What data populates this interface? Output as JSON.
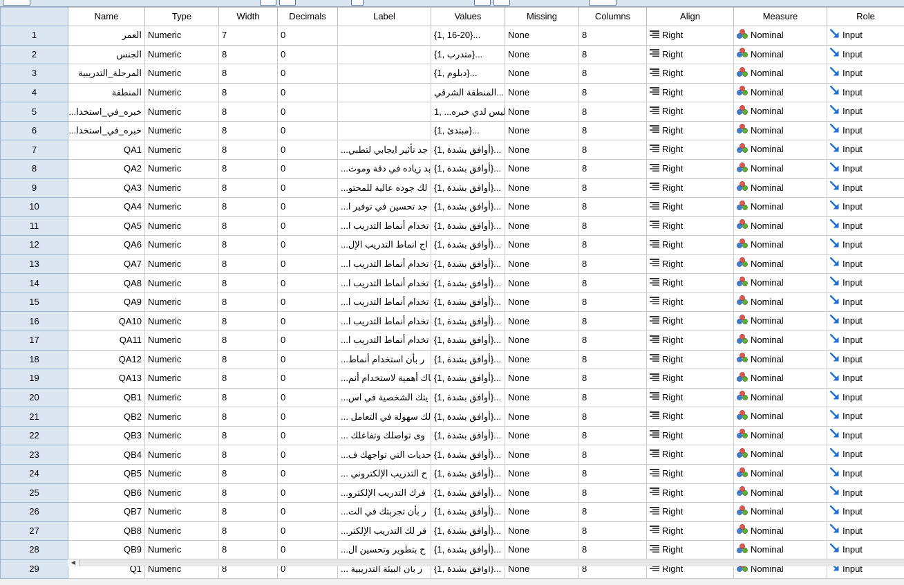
{
  "header": {
    "columns": [
      "Name",
      "Type",
      "Width",
      "Decimals",
      "Label",
      "Values",
      "Missing",
      "Columns",
      "Align",
      "Measure",
      "Role"
    ]
  },
  "rows": [
    {
      "n": "1",
      "name": "العمر",
      "type": "Numeric",
      "width": "7",
      "dec": "0",
      "label": "",
      "values": "{1, 16-20}...",
      "missing": "None",
      "cols": "8",
      "align": "Right",
      "measure": "Nominal",
      "role": "Input"
    },
    {
      "n": "2",
      "name": "الجنس",
      "type": "Numeric",
      "width": "8",
      "dec": "0",
      "label": "",
      "values": "{1, متدرب}...",
      "missing": "None",
      "cols": "8",
      "align": "Right",
      "measure": "Nominal",
      "role": "Input"
    },
    {
      "n": "3",
      "name": "المرحلة_التدريبية",
      "type": "Numeric",
      "width": "8",
      "dec": "0",
      "label": "",
      "values": "{1, دبلوم}...",
      "missing": "None",
      "cols": "8",
      "align": "Right",
      "measure": "Nominal",
      "role": "Input"
    },
    {
      "n": "4",
      "name": "المنطقة",
      "type": "Numeric",
      "width": "8",
      "dec": "0",
      "label": "",
      "values": "المنطقة الشرقي... ,",
      "missing": "None",
      "cols": "8",
      "align": "Right",
      "measure": "Nominal",
      "role": "Input"
    },
    {
      "n": "5",
      "name": "خبره_في_استخدا...",
      "type": "Numeric",
      "width": "8",
      "dec": "0",
      "label": "",
      "values": "ليس لدي خبره... ,1",
      "missing": "None",
      "cols": "8",
      "align": "Right",
      "measure": "Nominal",
      "role": "Input"
    },
    {
      "n": "6",
      "name": "خبره_في_استخدا...",
      "type": "Numeric",
      "width": "8",
      "dec": "0",
      "label": "",
      "values": "{1, مبتدئ}...",
      "missing": "None",
      "cols": "8",
      "align": "Right",
      "measure": "Nominal",
      "role": "Input"
    },
    {
      "n": "7",
      "name": "QA1",
      "type": "Numeric",
      "width": "8",
      "dec": "0",
      "label": "جد تأثير ايجابي لتطبي...",
      "values": "{1, أوافق بشدة}...",
      "missing": "None",
      "cols": "8",
      "align": "Right",
      "measure": "Nominal",
      "role": "Input"
    },
    {
      "n": "8",
      "name": "QA2",
      "type": "Numeric",
      "width": "8",
      "dec": "0",
      "label": "بد زياده في دقة وموث...",
      "values": "{1, أوافق بشدة}...",
      "missing": "None",
      "cols": "8",
      "align": "Right",
      "measure": "Nominal",
      "role": "Input"
    },
    {
      "n": "9",
      "name": "QA3",
      "type": "Numeric",
      "width": "8",
      "dec": "0",
      "label": "لك جوده عالية للمحتو...",
      "values": "{1, أوافق بشدة}...",
      "missing": "None",
      "cols": "8",
      "align": "Right",
      "measure": "Nominal",
      "role": "Input"
    },
    {
      "n": "10",
      "name": "QA4",
      "type": "Numeric",
      "width": "8",
      "dec": "0",
      "label": "جد تحسين في توفير ا...",
      "values": "{1, أوافق بشدة}...",
      "missing": "None",
      "cols": "8",
      "align": "Right",
      "measure": "Nominal",
      "role": "Input"
    },
    {
      "n": "11",
      "name": "QA5",
      "type": "Numeric",
      "width": "8",
      "dec": "0",
      "label": "تخدام أنماط التدريب ا...",
      "values": "{1, أوافق بشدة}...",
      "missing": "None",
      "cols": "8",
      "align": "Right",
      "measure": "Nominal",
      "role": "Input"
    },
    {
      "n": "12",
      "name": "QA6",
      "type": "Numeric",
      "width": "8",
      "dec": "0",
      "label": "اج انماط التدريب الإل...",
      "values": "{1, أوافق بشدة}...",
      "missing": "None",
      "cols": "8",
      "align": "Right",
      "measure": "Nominal",
      "role": "Input"
    },
    {
      "n": "13",
      "name": "QA7",
      "type": "Numeric",
      "width": "8",
      "dec": "0",
      "label": "تخدام أنماط التدريب ا...",
      "values": "{1, أوافق بشدة}...",
      "missing": "None",
      "cols": "8",
      "align": "Right",
      "measure": "Nominal",
      "role": "Input"
    },
    {
      "n": "14",
      "name": "QA8",
      "type": "Numeric",
      "width": "8",
      "dec": "0",
      "label": "تخدام أنماط التدريب ا...",
      "values": "{1, أوافق بشدة}...",
      "missing": "None",
      "cols": "8",
      "align": "Right",
      "measure": "Nominal",
      "role": "Input"
    },
    {
      "n": "15",
      "name": "QA9",
      "type": "Numeric",
      "width": "8",
      "dec": "0",
      "label": "تخدام أنماط التدريب ا...",
      "values": "{1, أوافق بشدة}...",
      "missing": "None",
      "cols": "8",
      "align": "Right",
      "measure": "Nominal",
      "role": "Input"
    },
    {
      "n": "16",
      "name": "QA10",
      "type": "Numeric",
      "width": "8",
      "dec": "0",
      "label": "تخدام أنماط التدريب ا...",
      "values": "{1, أوافق بشدة}...",
      "missing": "None",
      "cols": "8",
      "align": "Right",
      "measure": "Nominal",
      "role": "Input"
    },
    {
      "n": "17",
      "name": "QA11",
      "type": "Numeric",
      "width": "8",
      "dec": "0",
      "label": "تخدام أنماط التدريب ا...",
      "values": "{1, أوافق بشدة}...",
      "missing": "None",
      "cols": "8",
      "align": "Right",
      "measure": "Nominal",
      "role": "Input"
    },
    {
      "n": "18",
      "name": "QA12",
      "type": "Numeric",
      "width": "8",
      "dec": "0",
      "label": "ر بأن استخدام أنماط...",
      "values": "{1, أوافق بشدة}...",
      "missing": "None",
      "cols": "8",
      "align": "Right",
      "measure": "Nominal",
      "role": "Input"
    },
    {
      "n": "19",
      "name": "QA13",
      "type": "Numeric",
      "width": "8",
      "dec": "0",
      "label": "ناك أهمية لاستخدام أنم...",
      "values": "{1, أوافق بشدة}...",
      "missing": "None",
      "cols": "8",
      "align": "Right",
      "measure": "Nominal",
      "role": "Input"
    },
    {
      "n": "20",
      "name": "QB1",
      "type": "Numeric",
      "width": "8",
      "dec": "0",
      "label": "يتك الشخصية في اس...",
      "values": "{1, أوافق بشدة}...",
      "missing": "None",
      "cols": "8",
      "align": "Right",
      "measure": "Nominal",
      "role": "Input"
    },
    {
      "n": "21",
      "name": "QB2",
      "type": "Numeric",
      "width": "8",
      "dec": "0",
      "label": "لك سهولة في التعامل ...",
      "values": "{1, أوافق بشدة}...",
      "missing": "None",
      "cols": "8",
      "align": "Right",
      "measure": "Nominal",
      "role": "Input"
    },
    {
      "n": "22",
      "name": "QB3",
      "type": "Numeric",
      "width": "8",
      "dec": "0",
      "label": "وى تواصلك وتفاعلك ...",
      "values": "{1, أوافق بشدة}...",
      "missing": "None",
      "cols": "8",
      "align": "Right",
      "measure": "Nominal",
      "role": "Input"
    },
    {
      "n": "23",
      "name": "QB4",
      "type": "Numeric",
      "width": "8",
      "dec": "0",
      "label": "حديات التي تواجهك ف...",
      "values": "{1, أوافق بشدة}...",
      "missing": "None",
      "cols": "8",
      "align": "Right",
      "measure": "Nominal",
      "role": "Input"
    },
    {
      "n": "24",
      "name": "QB5",
      "type": "Numeric",
      "width": "8",
      "dec": "0",
      "label": "ح التدريب الإلكتروني ...",
      "values": "{1, أوافق بشدة}...",
      "missing": "None",
      "cols": "8",
      "align": "Right",
      "measure": "Nominal",
      "role": "Input"
    },
    {
      "n": "25",
      "name": "QB6",
      "type": "Numeric",
      "width": "8",
      "dec": "0",
      "label": "فرك التدريب الإلكترو...",
      "values": "{1, أوافق بشدة}...",
      "missing": "None",
      "cols": "8",
      "align": "Right",
      "measure": "Nominal",
      "role": "Input"
    },
    {
      "n": "26",
      "name": "QB7",
      "type": "Numeric",
      "width": "8",
      "dec": "0",
      "label": "ر بأن تجربتك في الت...",
      "values": "{1, أوافق بشدة}...",
      "missing": "None",
      "cols": "8",
      "align": "Right",
      "measure": "Nominal",
      "role": "Input"
    },
    {
      "n": "27",
      "name": "QB8",
      "type": "Numeric",
      "width": "8",
      "dec": "0",
      "label": "فر لك التدريب الإلكتر...",
      "values": "{1, أوافق بشدة}...",
      "missing": "None",
      "cols": "8",
      "align": "Right",
      "measure": "Nominal",
      "role": "Input"
    },
    {
      "n": "28",
      "name": "QB9",
      "type": "Numeric",
      "width": "8",
      "dec": "0",
      "label": "ح بتطوير وتحسين ال...",
      "values": "{1, أوافق بشدة}...",
      "missing": "None",
      "cols": "8",
      "align": "Right",
      "measure": "Nominal",
      "role": "Input"
    },
    {
      "n": "29",
      "name": "Q1",
      "type": "Numeric",
      "width": "8",
      "dec": "0",
      "label": "ر بأن البيئة التدريبية ...",
      "values": "{1, أوافق بشدة}...",
      "missing": "None",
      "cols": "8",
      "align": "Right",
      "measure": "Nominal",
      "role": "Input"
    }
  ],
  "icons": {
    "align": "align-right-icon",
    "measure": "nominal-icon",
    "role": "input-arrow-icon"
  },
  "colors": {
    "header_bg": "#dce6f2",
    "nominal_red": "#e2574c",
    "nominal_blue": "#3f7fd0",
    "nominal_green": "#5fae3a",
    "role_arrow": "#1f6fd1"
  }
}
